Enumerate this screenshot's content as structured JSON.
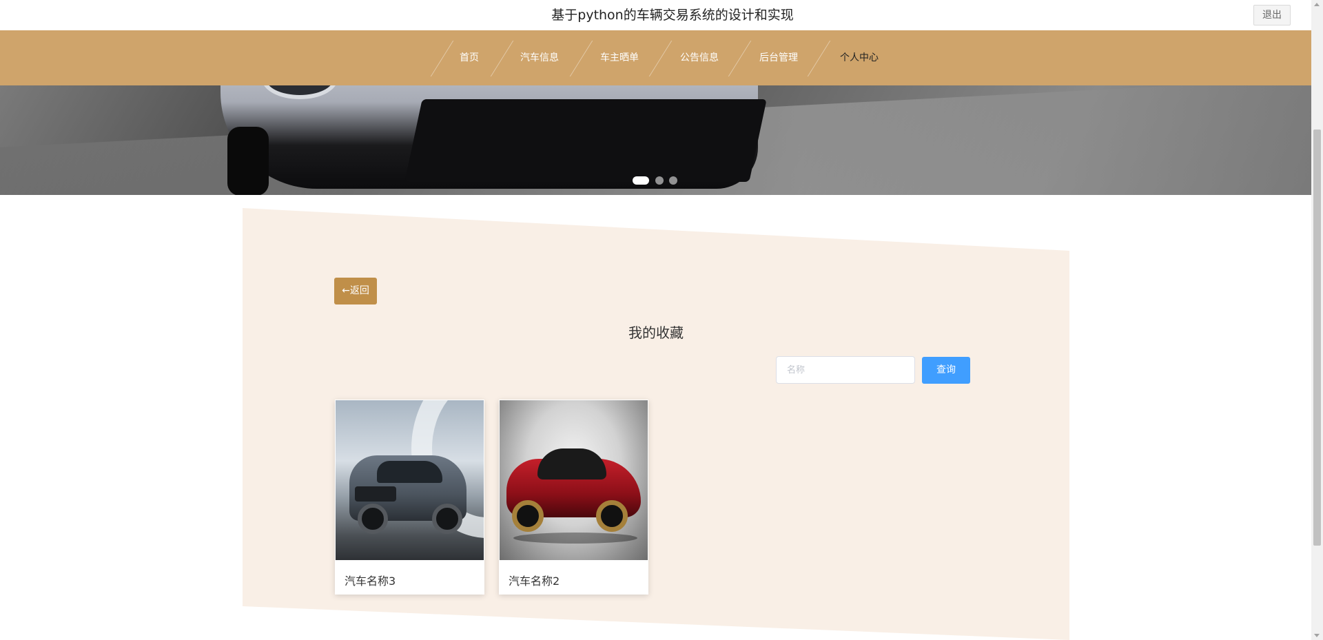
{
  "header": {
    "title": "基于python的车辆交易系统的设计和实现",
    "logout_label": "退出"
  },
  "nav": {
    "items": [
      {
        "label": "首页",
        "active": false
      },
      {
        "label": "汽车信息",
        "active": false
      },
      {
        "label": "车主晒单",
        "active": false
      },
      {
        "label": "公告信息",
        "active": false
      },
      {
        "label": "后台管理",
        "active": false
      },
      {
        "label": "个人中心",
        "active": true
      }
    ]
  },
  "carousel": {
    "slide_count": 3,
    "active_index": 0
  },
  "main": {
    "back_label": "←返回",
    "page_title": "我的收藏",
    "search": {
      "placeholder": "名称",
      "value": "",
      "button_label": "查询"
    },
    "favorites": [
      {
        "name": "汽车名称3",
        "image": "grey-suv"
      },
      {
        "name": "汽车名称2",
        "image": "red-sports-car"
      }
    ]
  },
  "colors": {
    "nav_bg": "#cfa46b",
    "panel_bg": "#f9efe6",
    "back_button": "#c08f49",
    "query_button": "#409eff"
  }
}
